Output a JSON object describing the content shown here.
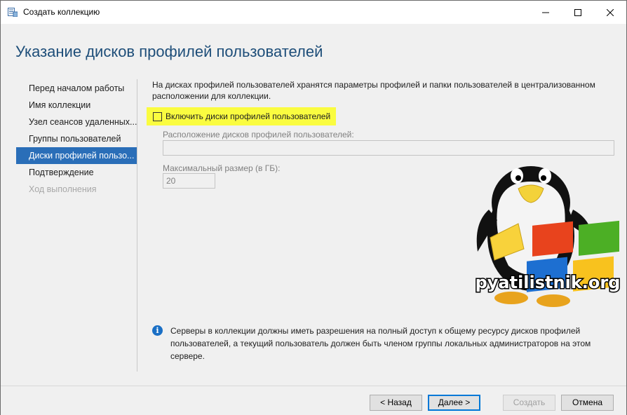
{
  "window": {
    "title": "Создать коллекцию",
    "icons": {
      "app": "collection-app-icon",
      "minimize": "minimize-icon",
      "maximize": "maximize-icon",
      "close": "close-icon"
    }
  },
  "page_title": "Указание дисков профилей пользователей",
  "sidebar": {
    "items": [
      {
        "label": "Перед началом работы",
        "state": "normal"
      },
      {
        "label": "Имя коллекции",
        "state": "normal"
      },
      {
        "label": "Узел сеансов удаленных...",
        "state": "normal"
      },
      {
        "label": "Группы пользователей",
        "state": "normal"
      },
      {
        "label": "Диски профилей пользо...",
        "state": "active"
      },
      {
        "label": "Подтверждение",
        "state": "normal"
      },
      {
        "label": "Ход выполнения",
        "state": "disabled"
      }
    ]
  },
  "content": {
    "description": "На дисках профилей пользователей хранятся параметры профилей и папки пользователей в централизованном расположении для коллекции.",
    "enable_checkbox_label": "Включить диски профилей пользователей",
    "enable_checked": false,
    "location_label": "Расположение дисков профилей пользователей:",
    "location_value": "",
    "max_size_label": "Максимальный размер (в ГБ):",
    "max_size_value": "20",
    "watermark_text": "pyatilistnik.org",
    "info_text": "Серверы в коллекции должны иметь разрешения на полный доступ к общему ресурсу дисков профилей пользователей, а текущий пользователь должен быть членом группы локальных администраторов на этом сервере."
  },
  "footer": {
    "back_label": "< Назад",
    "next_label": "Далее >",
    "create_label": "Создать",
    "cancel_label": "Отмена"
  },
  "colors": {
    "title": "#1e4e79",
    "active_nav": "#2a6eb8",
    "highlight": "#fafc40",
    "info_icon": "#1a6fc5"
  }
}
